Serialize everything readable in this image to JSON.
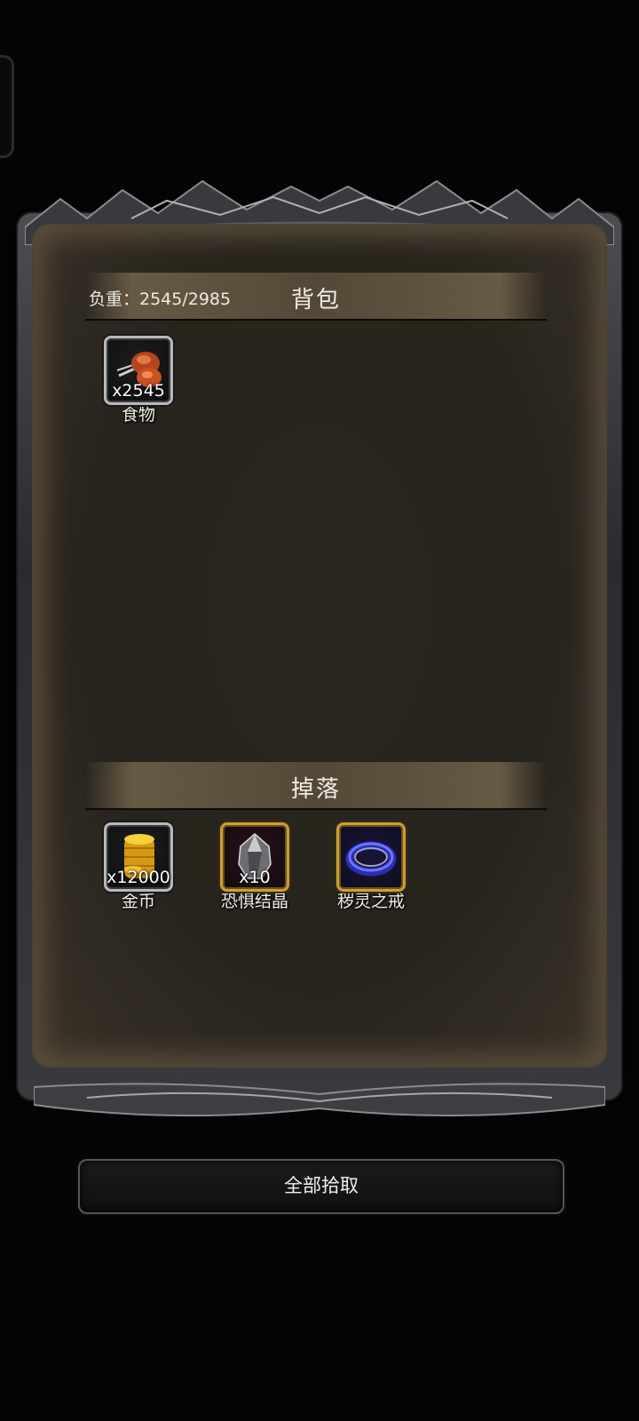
{
  "bag": {
    "title": "背包",
    "weight_label": "负重：2545/2985",
    "items": [
      {
        "name": "食物",
        "quantity": "x2545",
        "icon": "roast-meat-icon",
        "rarity": "common"
      }
    ]
  },
  "drops": {
    "title": "掉落",
    "items": [
      {
        "name": "金币",
        "quantity": "x12000",
        "icon": "gold-coins-icon",
        "rarity": "common"
      },
      {
        "name": "恐惧结晶",
        "quantity": "x10",
        "icon": "dark-crystal-icon",
        "rarity": "rare"
      },
      {
        "name": "秽灵之戒",
        "quantity": "",
        "icon": "ring-icon",
        "rarity": "rare"
      }
    ]
  },
  "actions": {
    "pickup_all_label": "全部拾取"
  },
  "colors": {
    "rare_border": "#c8a038",
    "common_border": "#b9b9bc",
    "parchment": "#27231d"
  }
}
